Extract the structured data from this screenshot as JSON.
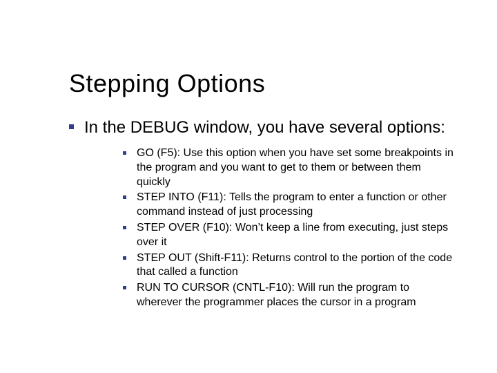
{
  "slide": {
    "title": "Stepping Options",
    "point": "In the DEBUG window, you have several options:",
    "items": [
      "GO (F5): Use this option when you have set some breakpoints in the program and you want to get to them or between them quickly",
      "STEP INTO (F11): Tells the program to enter a function or other command instead of just processing",
      "STEP OVER (F10): Won’t keep a line from executing, just steps over it",
      "STEP OUT (Shift-F11): Returns control to the portion of the code that called a function",
      "RUN TO CURSOR (CNTL-F10): Will run the program to wherever the programmer places the cursor in a program"
    ]
  }
}
